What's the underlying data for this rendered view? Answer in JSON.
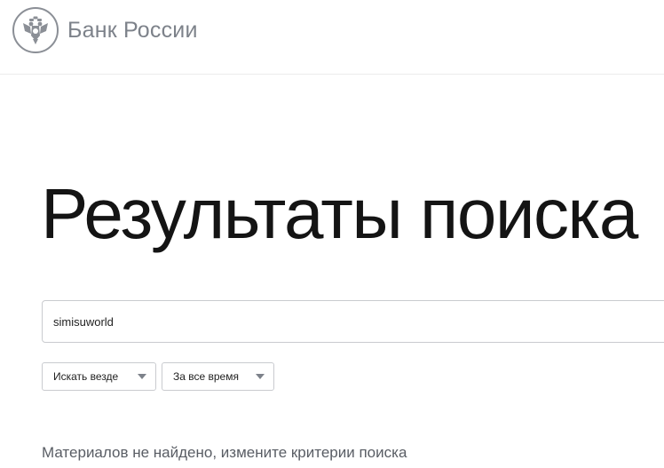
{
  "header": {
    "logo_text": "Банк России",
    "logo_icon": "double-headed-eagle-emblem-icon"
  },
  "main": {
    "title": "Результаты поиска",
    "search": {
      "value": "simisuworld",
      "placeholder": ""
    },
    "filters": {
      "scope": {
        "selected": "Искать везде"
      },
      "period": {
        "selected": "За все время"
      }
    },
    "message": "Материалов не найдено, измените критерии поиска"
  },
  "colors": {
    "logo_gray": "#7d828a",
    "title": "#141414",
    "border": "#c9cbcf",
    "message": "#595d64"
  }
}
